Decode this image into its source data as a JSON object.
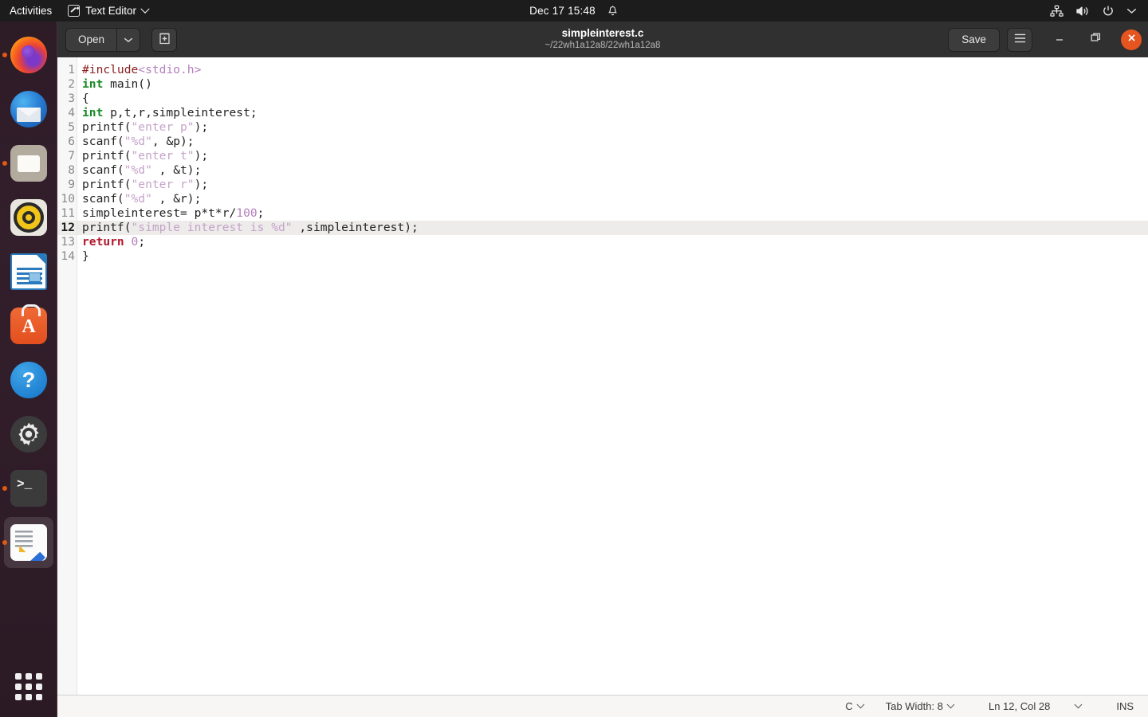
{
  "topbar": {
    "activities": "Activities",
    "app_name": "Text Editor",
    "app_icon": "text-editor-icon",
    "clock": "Dec 17  15:48",
    "bell_icon": "bell-icon",
    "network_icon": "network-wired-icon",
    "volume_icon": "volume-icon",
    "power_icon": "power-icon",
    "menu_chevron_icon": "chevron-down-icon"
  },
  "dock": {
    "items": [
      {
        "name": "firefox",
        "label": "Firefox",
        "running": true
      },
      {
        "name": "thunderbird",
        "label": "Thunderbird Mail",
        "running": false
      },
      {
        "name": "files",
        "label": "Files",
        "running": true
      },
      {
        "name": "rhythmbox",
        "label": "Rhythmbox",
        "running": false
      },
      {
        "name": "libreoffice-writer",
        "label": "LibreOffice Writer",
        "running": false
      },
      {
        "name": "ubuntu-software",
        "label": "Ubuntu Software",
        "running": false
      },
      {
        "name": "help",
        "label": "Help",
        "running": false
      },
      {
        "name": "settings",
        "label": "Settings",
        "running": false
      },
      {
        "name": "terminal",
        "label": "Terminal",
        "running": true
      },
      {
        "name": "text-editor",
        "label": "Text Editor",
        "running": true,
        "active": true
      }
    ],
    "show_apps_label": "Show Applications",
    "show_apps_icon": "grid-icon"
  },
  "window": {
    "title": "simpleinterest.c",
    "subtitle": "~/22wh1a12a8/22wh1a12a8",
    "open_label": "Open",
    "open_dropdown_icon": "chevron-down-icon",
    "new_document_icon": "new-document-icon",
    "save_label": "Save",
    "menu_icon": "hamburger-menu-icon",
    "minimize_icon": "minimize-icon",
    "maximize_icon": "maximize-icon",
    "close_icon": "close-icon"
  },
  "editor": {
    "line_numbers": [
      "1",
      "2",
      "3",
      "4",
      "5",
      "6",
      "7",
      "8",
      "9",
      "10",
      "11",
      "12",
      "13",
      "14"
    ],
    "current_line": 12,
    "lines": [
      {
        "n": "1",
        "tokens": [
          {
            "t": "#include",
            "c": "k-pre"
          },
          {
            "t": "<stdio.h>",
            "c": "k-inc"
          }
        ]
      },
      {
        "n": "2",
        "tokens": [
          {
            "t": "int",
            "c": "k-type"
          },
          {
            "t": " main()",
            "c": ""
          }
        ]
      },
      {
        "n": "3",
        "tokens": [
          {
            "t": "{",
            "c": ""
          }
        ]
      },
      {
        "n": "4",
        "tokens": [
          {
            "t": "int",
            "c": "k-type"
          },
          {
            "t": " p,t,r,simpleinterest;",
            "c": ""
          }
        ]
      },
      {
        "n": "5",
        "tokens": [
          {
            "t": "printf(",
            "c": ""
          },
          {
            "t": "\"enter p\"",
            "c": "k-str"
          },
          {
            "t": ");",
            "c": ""
          }
        ]
      },
      {
        "n": "6",
        "tokens": [
          {
            "t": "scanf(",
            "c": ""
          },
          {
            "t": "\"%d\"",
            "c": "k-str"
          },
          {
            "t": ", &p);",
            "c": ""
          }
        ]
      },
      {
        "n": "7",
        "tokens": [
          {
            "t": "printf(",
            "c": ""
          },
          {
            "t": "\"enter t\"",
            "c": "k-str"
          },
          {
            "t": ");",
            "c": ""
          }
        ]
      },
      {
        "n": "8",
        "tokens": [
          {
            "t": "scanf(",
            "c": ""
          },
          {
            "t": "\"%d\"",
            "c": "k-str"
          },
          {
            "t": " , &t);",
            "c": ""
          }
        ]
      },
      {
        "n": "9",
        "tokens": [
          {
            "t": "printf(",
            "c": ""
          },
          {
            "t": "\"enter r\"",
            "c": "k-str"
          },
          {
            "t": ");",
            "c": ""
          }
        ]
      },
      {
        "n": "10",
        "tokens": [
          {
            "t": "scanf(",
            "c": ""
          },
          {
            "t": "\"%d\"",
            "c": "k-str"
          },
          {
            "t": " , &r);",
            "c": ""
          }
        ]
      },
      {
        "n": "11",
        "tokens": [
          {
            "t": "simpleinterest= p*t*r/",
            "c": ""
          },
          {
            "t": "100",
            "c": "k-num"
          },
          {
            "t": ";",
            "c": ""
          }
        ]
      },
      {
        "n": "12",
        "tokens": [
          {
            "t": "printf(",
            "c": ""
          },
          {
            "t": "\"simple interest is %d\"",
            "c": "k-str"
          },
          {
            "t": " ,simpleinterest);",
            "c": ""
          }
        ]
      },
      {
        "n": "13",
        "tokens": [
          {
            "t": "return",
            "c": "k-ret"
          },
          {
            "t": " ",
            "c": ""
          },
          {
            "t": "0",
            "c": "k-num"
          },
          {
            "t": ";",
            "c": ""
          }
        ]
      },
      {
        "n": "14",
        "tokens": [
          {
            "t": "}",
            "c": ""
          }
        ]
      }
    ]
  },
  "statusbar": {
    "language": "C",
    "tab_width": "Tab Width: 8",
    "position": "Ln 12, Col 28",
    "insert_mode": "INS",
    "chevron_icon": "chevron-down-icon"
  },
  "colors": {
    "accent": "#e6541f",
    "headerbar": "#303030",
    "topbar": "#1c1c1c",
    "current_line": "#edecea",
    "keyword_type": "#1a8a26",
    "keyword_return": "#b2182b",
    "string": "#c5a3c9",
    "preprocessor": "#8b2020",
    "include_path": "#b37fbd"
  }
}
